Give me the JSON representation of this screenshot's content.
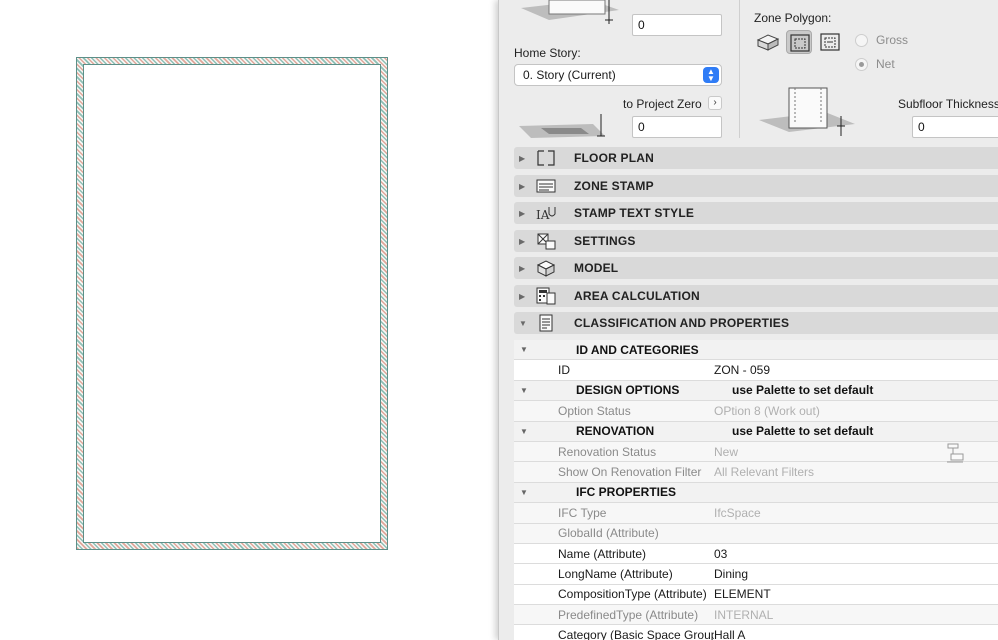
{
  "panel": {
    "top_height_value": "0",
    "home_story": {
      "label": "Home Story:",
      "selected": "0. Story (Current)"
    },
    "project_zero": {
      "label": "to Project Zero",
      "value": "0"
    },
    "zone_polygon": {
      "label": "Zone Polygon:",
      "options": [
        "Gross",
        "Net"
      ],
      "selected": "Net"
    },
    "subfloor": {
      "label": "Subfloor Thickness",
      "value": "0"
    }
  },
  "sections": [
    {
      "title": "FLOOR PLAN",
      "icon": "floor-plan-icon",
      "expanded": false
    },
    {
      "title": "ZONE STAMP",
      "icon": "zone-stamp-icon",
      "expanded": false
    },
    {
      "title": "STAMP TEXT STYLE",
      "icon": "stamp-text-style-icon",
      "expanded": false
    },
    {
      "title": "SETTINGS",
      "icon": "settings-icon",
      "expanded": false
    },
    {
      "title": "MODEL",
      "icon": "model-icon",
      "expanded": false
    },
    {
      "title": "AREA CALCULATION",
      "icon": "area-calculation-icon",
      "expanded": false
    },
    {
      "title": "CLASSIFICATION AND PROPERTIES",
      "icon": "classification-properties-icon",
      "expanded": true
    }
  ],
  "properties": [
    {
      "type": "group",
      "name": "ID AND CATEGORIES",
      "value": ""
    },
    {
      "type": "row",
      "name": "ID",
      "value": "ZON - 059"
    },
    {
      "type": "group",
      "name": "DESIGN OPTIONS",
      "value": "use Palette to set default"
    },
    {
      "type": "dim",
      "name": "Option Status",
      "value": "OPtion 8 (Work out)"
    },
    {
      "type": "group",
      "name": "RENOVATION",
      "value": "use Palette to set default"
    },
    {
      "type": "dim",
      "name": "Renovation Status",
      "value": "New"
    },
    {
      "type": "dim",
      "name": "Show On Renovation Filter",
      "value": "All Relevant Filters"
    },
    {
      "type": "group",
      "name": "IFC PROPERTIES",
      "value": ""
    },
    {
      "type": "dim",
      "name": "IFC Type",
      "value": "IfcSpace"
    },
    {
      "type": "dim",
      "name": "GlobalId (Attribute)",
      "value": ""
    },
    {
      "type": "row",
      "name": "Name (Attribute)",
      "value": "03"
    },
    {
      "type": "row",
      "name": "LongName (Attribute)",
      "value": "Dining"
    },
    {
      "type": "row",
      "name": "CompositionType (Attribute)",
      "value": "ELEMENT"
    },
    {
      "type": "dim",
      "name": "PredefinedType (Attribute)",
      "value": "INTERNAL"
    },
    {
      "type": "row",
      "name": "Category (Basic Space Group)",
      "value": "Hall A"
    }
  ],
  "colors": {
    "accent": "#2f7cf6",
    "zone_outline": "#5d8f88"
  }
}
